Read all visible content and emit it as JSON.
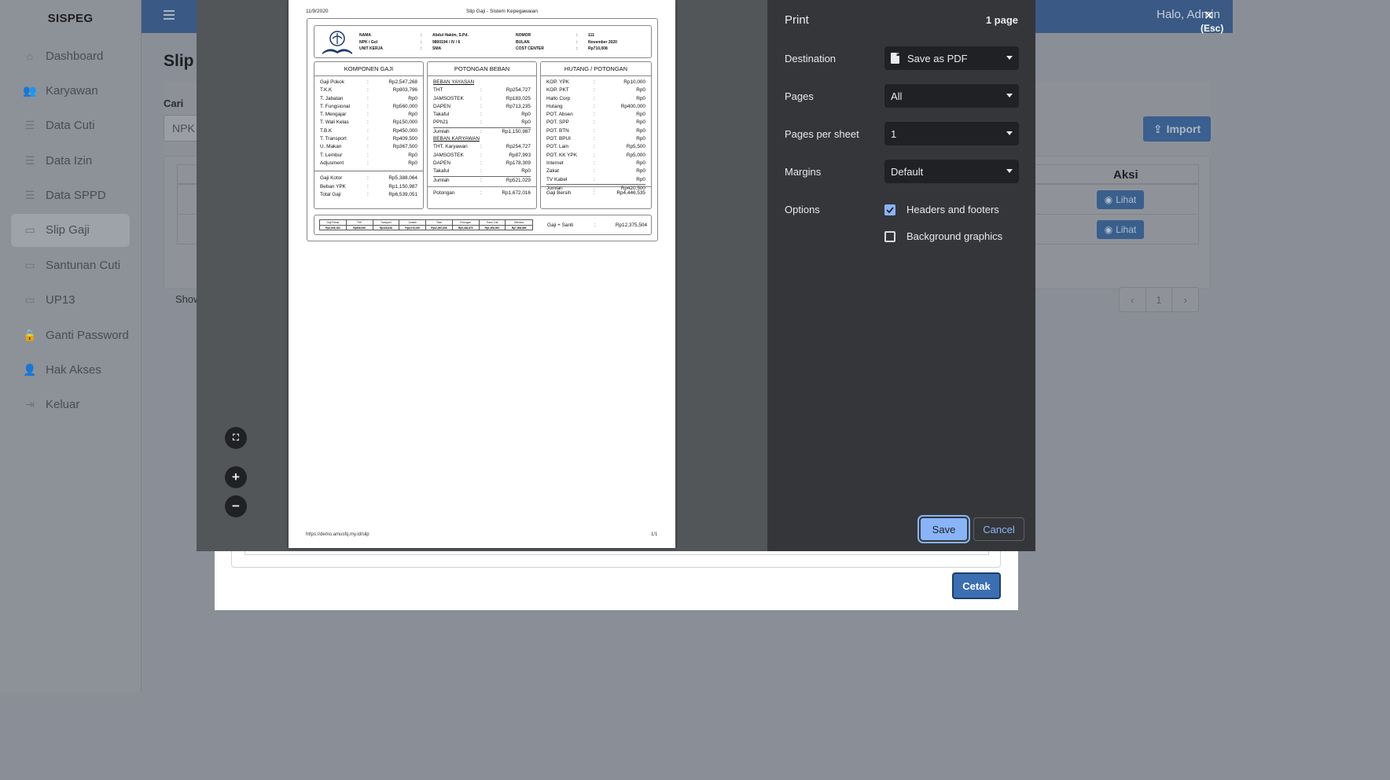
{
  "app": {
    "brand": "SISPEG",
    "greeting": "Halo, Admin",
    "page_title": "Slip",
    "cari_label": "Cari",
    "search_placeholder": "NPK",
    "import_label": "Import",
    "aksi_header": "Aksi",
    "lihat_label": "Lihat",
    "show_label": "Show",
    "pager": {
      "prev": "‹",
      "page": "1",
      "next": "›"
    },
    "cetak_label": "Cetak",
    "nav": [
      {
        "label": "Dashboard",
        "icon": "home-icon"
      },
      {
        "label": "Karyawan",
        "icon": "users-icon"
      },
      {
        "label": "Data Cuti",
        "icon": "list-icon"
      },
      {
        "label": "Data Izin",
        "icon": "list-icon"
      },
      {
        "label": "Data SPPD",
        "icon": "list-icon"
      },
      {
        "label": "Slip Gaji",
        "icon": "money-icon"
      },
      {
        "label": "Santunan Cuti",
        "icon": "money-icon"
      },
      {
        "label": "UP13",
        "icon": "money-icon"
      },
      {
        "label": "Ganti Password",
        "icon": "lock-icon"
      },
      {
        "label": "Hak Akses",
        "icon": "user-lock-icon"
      },
      {
        "label": "Keluar",
        "icon": "sign-out-icon"
      }
    ],
    "active_nav": "Slip Gaji"
  },
  "print": {
    "title": "Print",
    "page_count": "1 page",
    "destination_label": "Destination",
    "destination_value": "Save as PDF",
    "pages_label": "Pages",
    "pages_value": "All",
    "pps_label": "Pages per sheet",
    "pps_value": "1",
    "margins_label": "Margins",
    "margins_value": "Default",
    "options_label": "Options",
    "opt_headers": "Headers and footers",
    "opt_headers_checked": true,
    "opt_bg": "Background graphics",
    "opt_bg_checked": false,
    "save_label": "Save",
    "cancel_label": "Cancel",
    "close_label": "✕",
    "esc_label": "(Esc)",
    "colors": {
      "accent": "#8ab4f8",
      "panel": "#35363a",
      "field": "#202124"
    }
  },
  "doc": {
    "date": "11/9/2020",
    "title": "Slip Gaji - Sistem Kepegawaian",
    "url": "https://demo.amusfq.my.id/slip",
    "page": "1/1",
    "identity": {
      "nama_label": "NAMA",
      "nama": "Abdul Hakim, S.Pd.",
      "npk_label": "NPK / Gol",
      "npk": "9800194 / IV / 6",
      "unit_label": "UNIT KERJA",
      "unit": "SMA",
      "nomor_label": "NOMOR",
      "nomor": "111",
      "bulan_label": "BULAN",
      "bulan": "November 2020",
      "cost_label": "COST CENTER",
      "cost": "Rp710,008"
    },
    "komponen": {
      "title": "KOMPONEN GAJI",
      "rows": [
        [
          "Gaji Pokok",
          "Rp2,547,268"
        ],
        [
          "T.K.K",
          "Rp903,796"
        ],
        [
          "T. Jabatan",
          "Rp0"
        ],
        [
          "T. Fungsional",
          "Rp560,000"
        ],
        [
          "T. Mengajar",
          "Rp0"
        ],
        [
          "T. Wali Kelas",
          "Rp150,000"
        ],
        [
          "T.B.K",
          "Rp450,000"
        ],
        [
          "T. Transport",
          "Rp409,500"
        ],
        [
          "U. Makan",
          "Rp367,500"
        ],
        [
          "T. Lembur",
          "Rp0"
        ],
        [
          "Adjusment",
          "Rp0"
        ]
      ],
      "totals": [
        [
          "Gaji Kotor",
          "Rp5,388,064"
        ],
        [
          "Beban YPK",
          "Rp1,150,987"
        ],
        [
          "Total Gaji",
          "Rp6,539,051"
        ]
      ]
    },
    "potongan": {
      "title": "POTONGAN BEBAN",
      "yayasan_head": "BEBAN YAYASAN",
      "yayasan": [
        [
          "THT",
          "Rp254,727"
        ],
        [
          "JAMSOSTEK",
          "Rp183,025"
        ],
        [
          "DAPEN",
          "Rp713,235"
        ],
        [
          "Takaful",
          "Rp0"
        ],
        [
          "PPh21",
          "Rp0"
        ]
      ],
      "yayasan_total": [
        "Jumlah",
        "Rp1,150,987"
      ],
      "karyawan_head": "BEBAN KARYAWAN",
      "karyawan": [
        [
          "THT. Karyawan",
          "Rp254,727"
        ],
        [
          "JAMSOSTEK",
          "Rp87,993"
        ],
        [
          "DAPEN",
          "Rp178,309"
        ],
        [
          "Takaful",
          "Rp0"
        ]
      ],
      "karyawan_total": [
        "Jumlah",
        "Rp521,029"
      ],
      "foot": [
        "Potongan",
        "Rp1,672,016"
      ]
    },
    "hutang": {
      "title": "HUTANG / POTONGAN",
      "rows": [
        [
          "KOP. YPK",
          "Rp10,000"
        ],
        [
          "KOP. PKT",
          "Rp0"
        ],
        [
          "Hallo Corp",
          "Rp0"
        ],
        [
          "Hutang",
          "Rp400,000"
        ],
        [
          "POT. Absen",
          "Rp0"
        ],
        [
          "POT. SPP",
          "Rp0"
        ],
        [
          "POT. BTN",
          "Rp0"
        ],
        [
          "POT. BPUI",
          "Rp0"
        ],
        [
          "POT. Lain",
          "Rp5,500"
        ],
        [
          "POT. KK YPK",
          "Rp5,000"
        ],
        [
          "Internet",
          "Rp0"
        ],
        [
          "Zakat",
          "Rp0"
        ],
        [
          "TV Kabel",
          "Rp0"
        ]
      ],
      "total": [
        "Jumlah",
        "Rp420,500"
      ],
      "foot": [
        "Gaji Bersih",
        "Rp4,446,535"
      ]
    },
    "mini_table": {
      "headers": [
        "Gaji Pokok",
        "TKK",
        "Transport",
        "Jumlah",
        "Total",
        "Potongan",
        "Trans Cuti",
        "Diterima"
      ],
      "values": [
        "Rp2,849,183",
        "Rp838,940",
        "Rp426,838",
        "Rp4,015,156",
        "Rp12,887,838",
        "Rp5,438,878",
        "Rp1,508,000",
        "Rp7,808,888"
      ]
    },
    "gaji_santi": [
      "Gaji + Santi",
      "Rp12,375,504"
    ]
  }
}
